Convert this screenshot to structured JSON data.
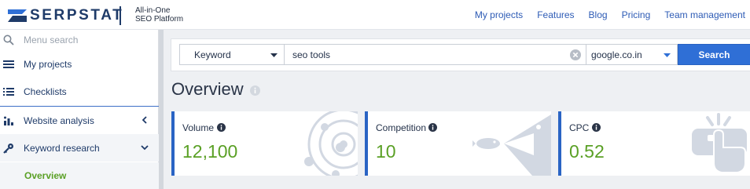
{
  "brand": {
    "name": "SERPSTAT",
    "tagline_line1": "All-in-One",
    "tagline_line2": "SEO Platform"
  },
  "topnav": [
    "My projects",
    "Features",
    "Blog",
    "Pricing",
    "Team management"
  ],
  "sidebar": {
    "search_placeholder": "Menu search",
    "items": [
      {
        "label": "My projects",
        "icon": "menu-icon"
      },
      {
        "label": "Checklists",
        "icon": "checklist-icon"
      },
      {
        "label": "Website analysis",
        "icon": "chart-icon",
        "chevron": "left"
      },
      {
        "label": "Keyword research",
        "icon": "key-icon",
        "chevron": "down"
      }
    ],
    "subitem": "Overview"
  },
  "search": {
    "type_value": "Keyword",
    "keyword_value": "seo tools",
    "database_value": "google.co.in",
    "button_label": "Search"
  },
  "overview": {
    "title": "Overview",
    "cards": [
      {
        "label": "Volume",
        "value": "12,100",
        "illustration": "orbit-icon"
      },
      {
        "label": "Competition",
        "value": "10",
        "illustration": "fish-icon"
      },
      {
        "label": "CPC",
        "value": "0.52",
        "illustration": "click-icon"
      }
    ]
  },
  "colors": {
    "brand_navy": "#1f3b69",
    "link_blue": "#2d5bb5",
    "accent_blue": "#2f6fd6",
    "value_green": "#5aa025",
    "illustration_gray": "#d2d8e2"
  }
}
